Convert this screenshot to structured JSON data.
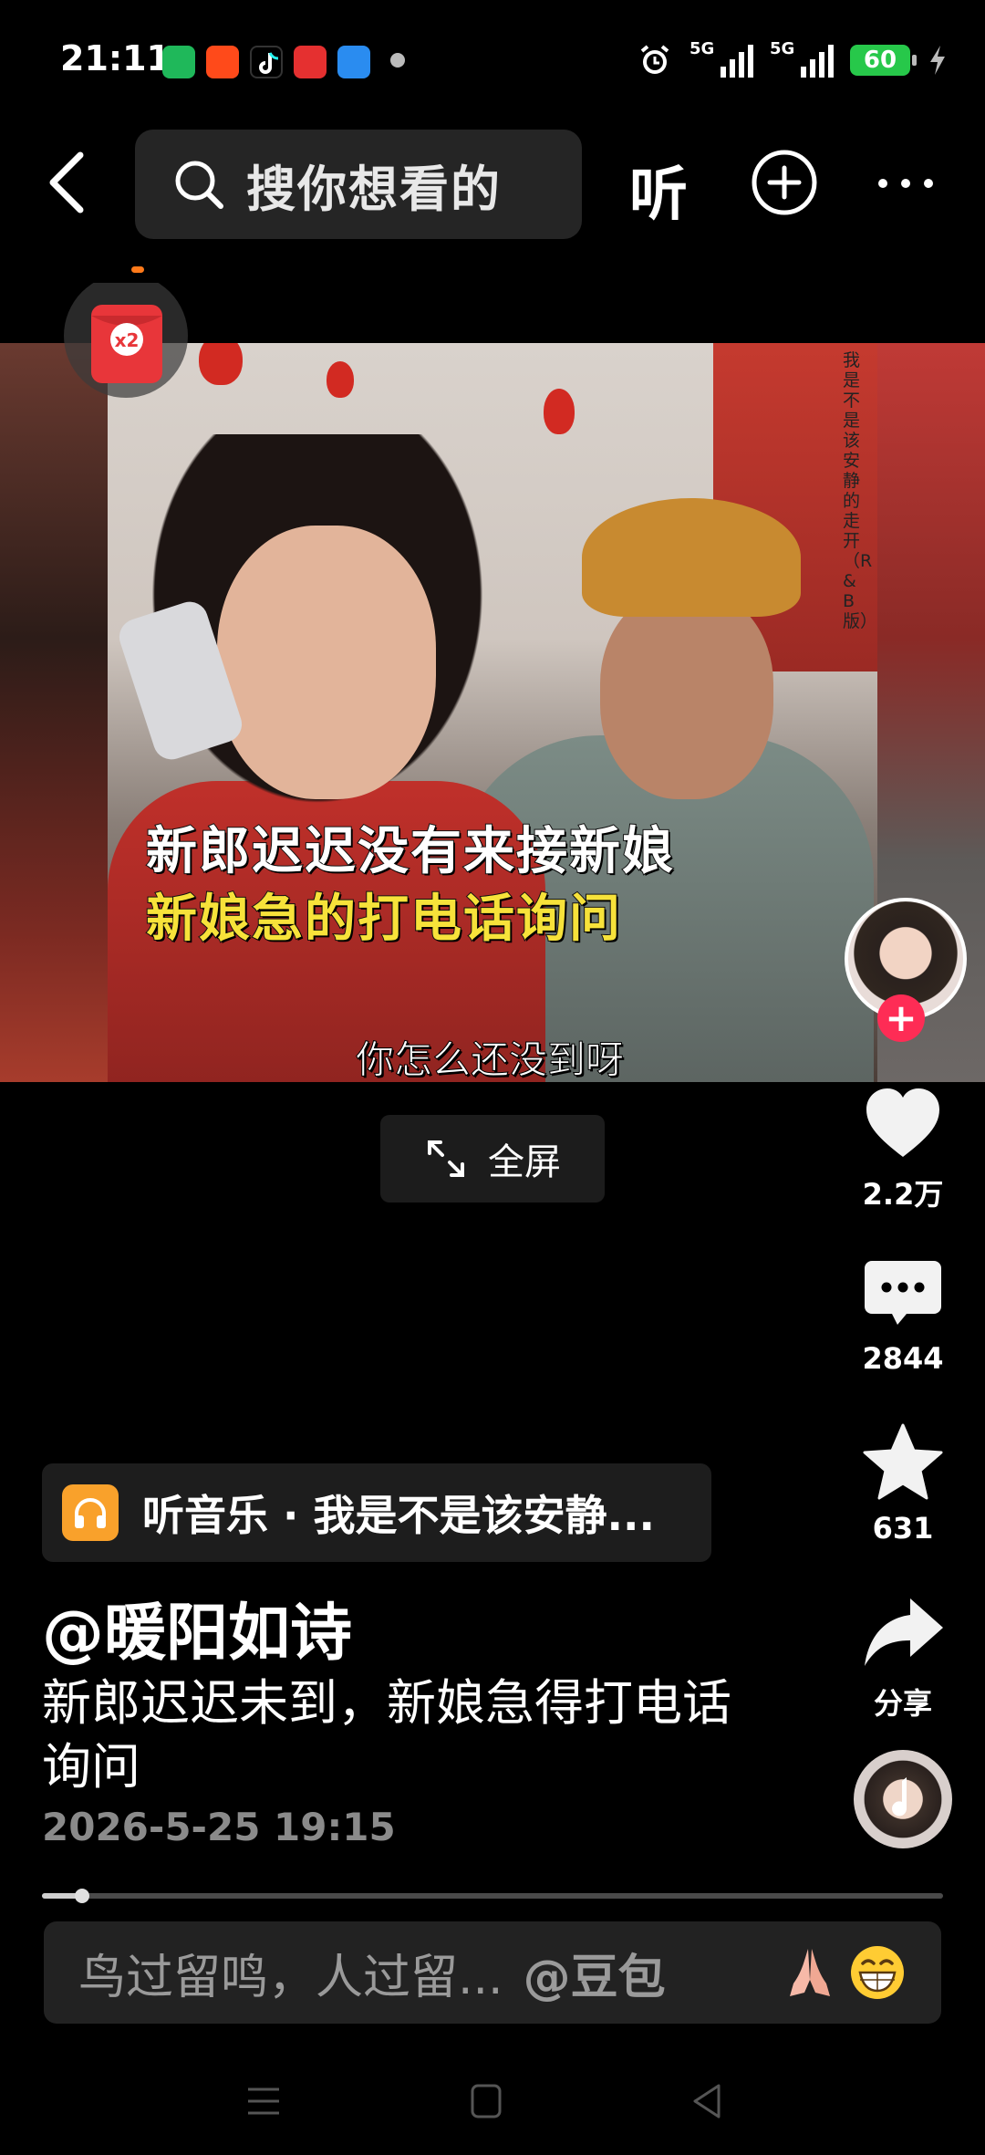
{
  "status_bar": {
    "time": "21:11",
    "signal1_label": "5G",
    "signal2_label": "5G",
    "battery": "60"
  },
  "topnav": {
    "search_placeholder": "搜你想看的",
    "listen_label": "听"
  },
  "badge": {
    "label": "x2"
  },
  "video": {
    "side_text": "我是不是该安静的走开（R&B版）",
    "caption_line1": "新郎迟迟没有来接新娘",
    "caption_line2": "新娘急的打电话询问",
    "subtitle": "你怎么还没到呀"
  },
  "fullscreen": {
    "label": "全屏"
  },
  "rail": {
    "likes": "2.2万",
    "comments": "2844",
    "favorites": "631",
    "share": "分享"
  },
  "info": {
    "music": "听音乐 · 我是不是该安静...",
    "author": "@暖阳如诗",
    "description": "新郎迟迟未到，新娘急得打电话询问",
    "datetime": "2026-5-25 19:15"
  },
  "progress": {
    "value": 0.045
  },
  "comment": {
    "placeholder": "鸟过留鸣，人过留...",
    "mention": "@豆包"
  },
  "colors": {
    "accent": "#fe2c55",
    "battery": "#27c84a",
    "music_icon": "#f9a12b",
    "caption_yellow": "#f7e23a"
  },
  "icons": [
    "back-arrow-icon",
    "search-icon",
    "plus-circle-icon",
    "more-icon",
    "heart-icon",
    "comment-icon",
    "star-icon",
    "share-icon",
    "headphones-icon",
    "expand-icon",
    "pray-emoji-icon",
    "grin-emoji-icon",
    "menu-icon",
    "home-icon",
    "back-triangle-icon"
  ]
}
